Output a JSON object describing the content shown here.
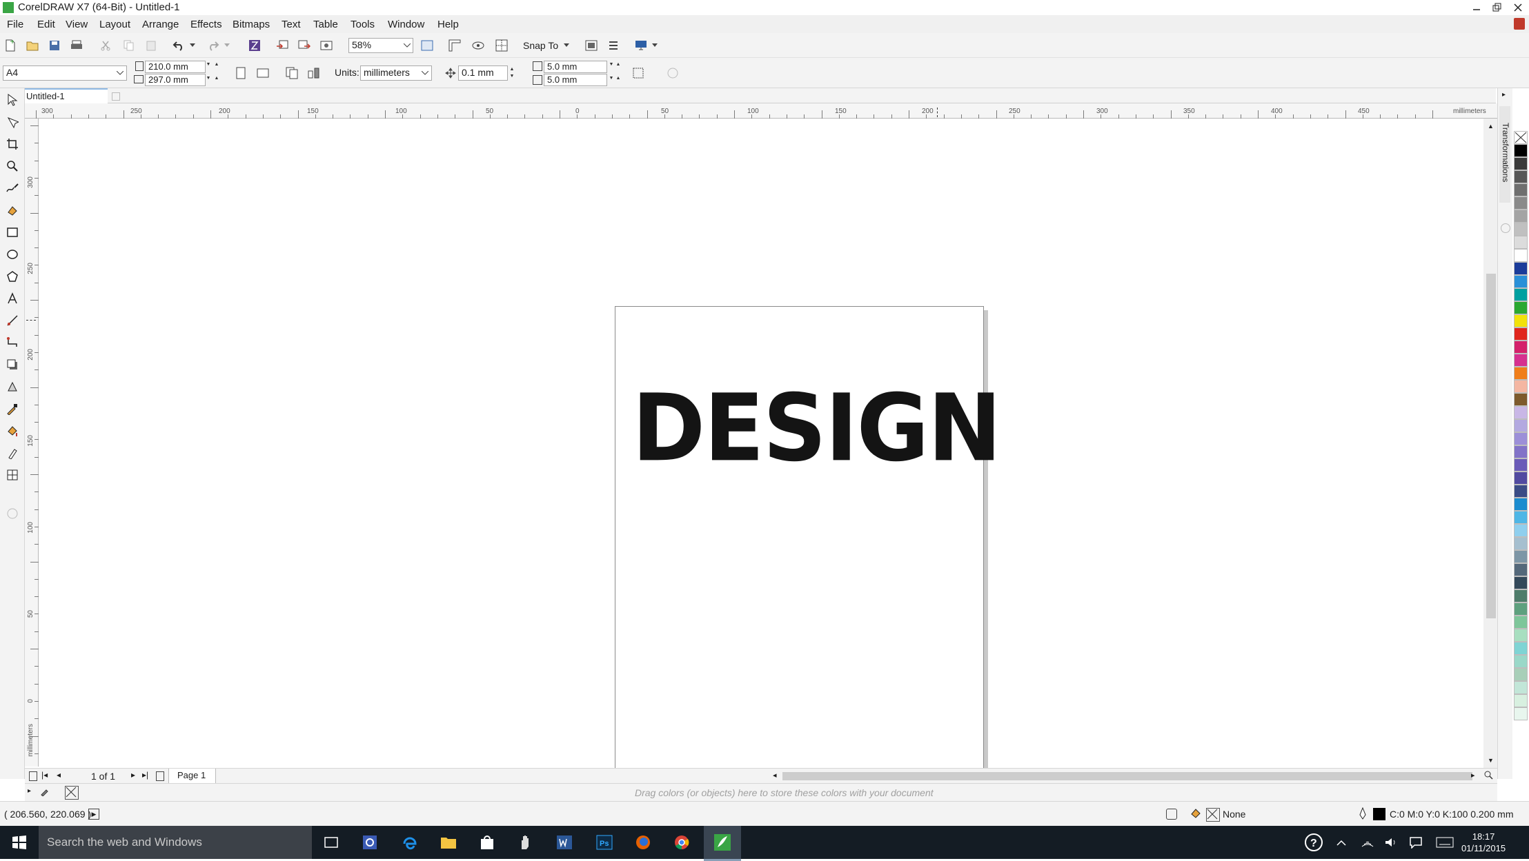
{
  "window": {
    "title": "CorelDRAW X7 (64-Bit) - Untitled-1"
  },
  "menu": [
    {
      "label": "File"
    },
    {
      "label": "Edit"
    },
    {
      "label": "View"
    },
    {
      "label": "Layout"
    },
    {
      "label": "Arrange"
    },
    {
      "label": "Effects"
    },
    {
      "label": "Bitmaps"
    },
    {
      "label": "Text"
    },
    {
      "label": "Table"
    },
    {
      "label": "Tools"
    },
    {
      "label": "Window"
    },
    {
      "label": "Help"
    }
  ],
  "toolbar": {
    "zoom": "58%",
    "snap_to": "Snap To"
  },
  "propertybar": {
    "page_size": "A4",
    "width": "210.0 mm",
    "height": "297.0 mm",
    "units_label": "Units:",
    "units_value": "millimeters",
    "nudge": "0.1 mm",
    "dup_x": "5.0 mm",
    "dup_y": "5.0 mm"
  },
  "doc_tab": "Untitled-1",
  "ruler": {
    "h_numbers": [
      "300",
      "250",
      "200",
      "150",
      "100",
      "50",
      "0",
      "50",
      "100",
      "150",
      "200",
      "250",
      "300",
      "350",
      "400",
      "450"
    ],
    "h_unit": "millimeters",
    "v_numbers": [
      "300",
      "250",
      "200",
      "150",
      "100",
      "50",
      "0"
    ],
    "v_unit": "millimeters"
  },
  "canvas": {
    "artwork_text": "DESIGN"
  },
  "page_nav": {
    "count": "1 of 1",
    "tab": "Page 1"
  },
  "color_tray": {
    "hint": "Drag colors (or objects) here to store these colors with your document"
  },
  "docker": {
    "title": "Transformations"
  },
  "status": {
    "coords": "( 206.560, 220.069 )",
    "fill": "None",
    "outline": "C:0 M:0 Y:0 K:100  0.200 mm"
  },
  "taskbar": {
    "search_placeholder": "Search the web and Windows",
    "time": "18:17",
    "date": "01/11/2015"
  },
  "palette": [
    "#000000",
    "#3a3a3a",
    "#575757",
    "#6f6f6f",
    "#8a8a8a",
    "#a4a4a4",
    "#c0c0c0",
    "#dcdcdc",
    "#ffffff",
    "#1b3c9a",
    "#2a90d8",
    "#00a0a0",
    "#2aa830",
    "#f2e20b",
    "#e0261d",
    "#d4216b",
    "#d6308f",
    "#f07e1a",
    "#f4b6a2",
    "#7d5a2c",
    "#c9b7e6",
    "#b3a9e0",
    "#9c8fd8",
    "#8273c8",
    "#6a5bb8",
    "#514aa0",
    "#3b4c86",
    "#1c8ccf",
    "#4eb6e6",
    "#8fcfee",
    "#a5bfcf",
    "#7d96a6",
    "#54687a",
    "#34495a",
    "#4e7c6a",
    "#5ea07e",
    "#7ec69a",
    "#a8dfc0",
    "#7fd4d4",
    "#9ad8c8",
    "#a8cfb8",
    "#c2e6d8",
    "#d8f0e0",
    "#e8f6ee"
  ]
}
